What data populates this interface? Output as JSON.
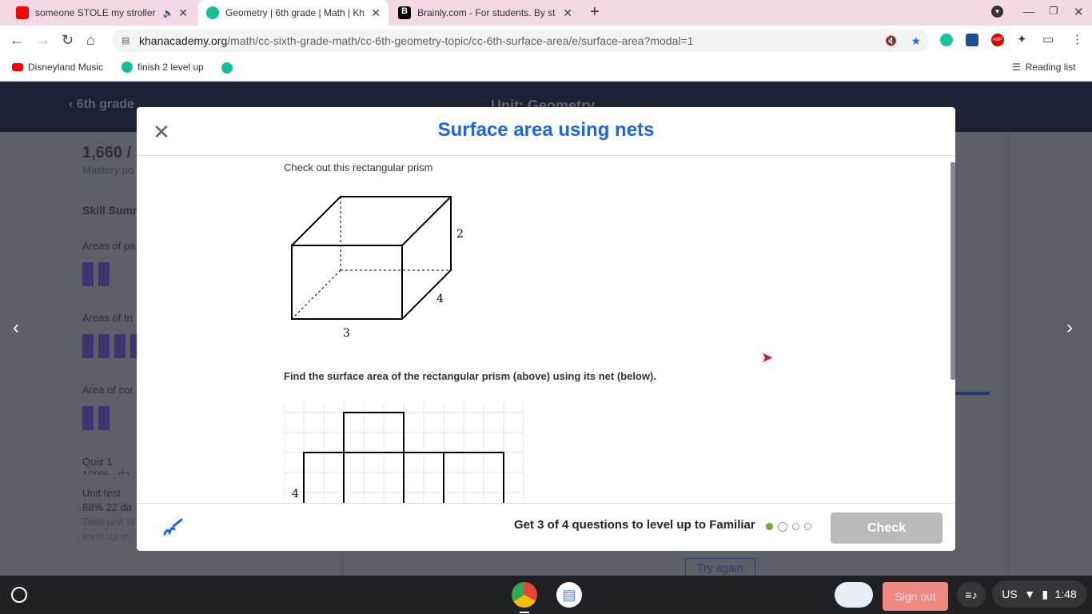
{
  "browser": {
    "tabs": [
      {
        "title": "someone STOLE my stroller",
        "favicon": "youtube-icon",
        "active": false
      },
      {
        "title": "Geometry | 6th grade | Math | Kh",
        "favicon": "khan-icon",
        "active": true
      },
      {
        "title": "Brainly.com - For students. By st",
        "favicon": "brainly-icon",
        "active": false
      }
    ],
    "url_domain": "khanacademy.org",
    "url_path": "/math/cc-sixth-grade-math/cc-6th-geometry-topic/cc-6th-surface-area/e/surface-area?modal=1",
    "bookmarks": [
      "Disneyland Music",
      "finish 2 level up"
    ],
    "reading_list": "Reading list"
  },
  "background": {
    "back_link": "6th grade",
    "unit_title": "Unit: Geometry",
    "points": "1,660 /",
    "points_label": "Mastery po",
    "skill_summary": "Skill Summ",
    "skills": [
      "Areas of pa",
      "Areas of tri",
      "Area of cor"
    ],
    "quiz": "Quiz 1",
    "quiz_sub": "100% · da",
    "unit_test": "Unit test",
    "unit_test_score": "88% 22 da",
    "unit_test_desc1": "Take unit te",
    "unit_test_desc2": "level up in",
    "try_again": "Try again"
  },
  "modal": {
    "title": "Surface area using nets",
    "intro": "Check out this rectangular prism",
    "prism": {
      "height": "2",
      "depth": "4",
      "width": "3"
    },
    "question": "Find the surface area of the rectangular prism (above) using its net (below).",
    "net_label": "4",
    "footer_text": "Get 3 of 4 questions to level up to Familiar",
    "progress_total": 4,
    "progress_done": 1,
    "check_label": "Check",
    "accent": "#1865f2"
  },
  "shelf": {
    "sign_out": "Sign out",
    "locale": "US",
    "time": "1:48"
  }
}
